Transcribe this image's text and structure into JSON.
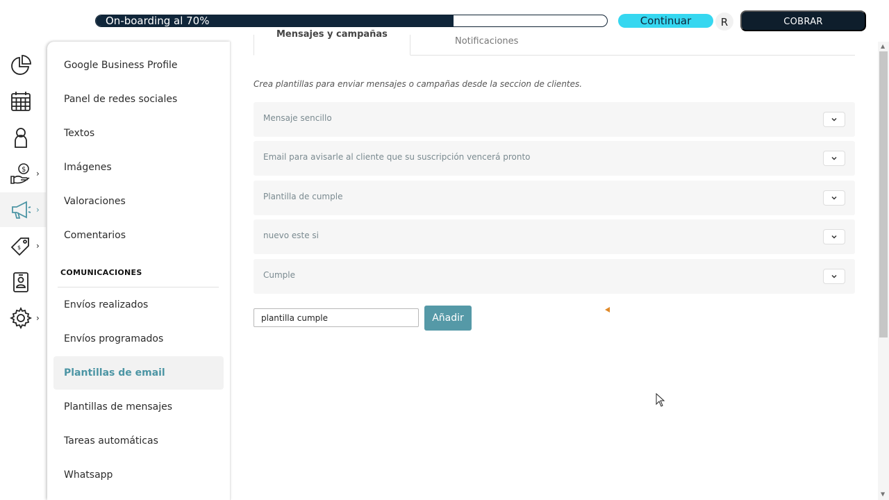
{
  "topbar": {
    "progress_label": "On-boarding al 70%",
    "progress_value": 0.7,
    "continue_label": "Continuar",
    "user_initial": "R",
    "charge_label": "COBRAR"
  },
  "rail": [
    {
      "icon": "chart-pie-icon"
    },
    {
      "icon": "calendar-icon"
    },
    {
      "icon": "user-icon"
    },
    {
      "icon": "money-hand-icon",
      "has_submenu": true
    },
    {
      "icon": "megaphone-icon",
      "has_submenu": true,
      "active": true
    },
    {
      "icon": "tags-icon",
      "has_submenu": true
    },
    {
      "icon": "contact-card-icon"
    },
    {
      "icon": "gear-icon",
      "has_submenu": true
    }
  ],
  "sidebar": {
    "items_top": [
      {
        "label": "Google Business Profile"
      },
      {
        "label": "Panel de redes sociales"
      },
      {
        "label": "Textos"
      },
      {
        "label": "Imágenes"
      },
      {
        "label": "Valoraciones"
      },
      {
        "label": "Comentarios"
      }
    ],
    "section_title": "COMUNICACIONES",
    "items_bottom": [
      {
        "label": "Envíos realizados"
      },
      {
        "label": "Envíos programados"
      },
      {
        "label": "Plantillas de email",
        "active": true
      },
      {
        "label": "Plantillas de mensajes"
      },
      {
        "label": "Tareas automáticas"
      },
      {
        "label": "Whatsapp"
      }
    ]
  },
  "main": {
    "tabs": [
      {
        "label": "Mensajes y campañas",
        "active": true
      },
      {
        "label": "Notificaciones"
      }
    ],
    "description": "Crea plantillas para enviar mensajes o campañas desde la seccion de clientes.",
    "templates": [
      {
        "label": "Mensaje sencillo"
      },
      {
        "label": "Email para avisarle al cliente que su suscripción vencerá pronto"
      },
      {
        "label": "Plantilla de cumple"
      },
      {
        "label": "nuevo este si"
      },
      {
        "label": "Cumple"
      }
    ],
    "new_template_value": "plantilla cumple",
    "add_label": "Añadir"
  },
  "colors": {
    "primary_dark": "#0e1e2c",
    "accent_cyan": "#36d7f0",
    "teal": "#5599a7",
    "active_text": "#4c95a4"
  }
}
